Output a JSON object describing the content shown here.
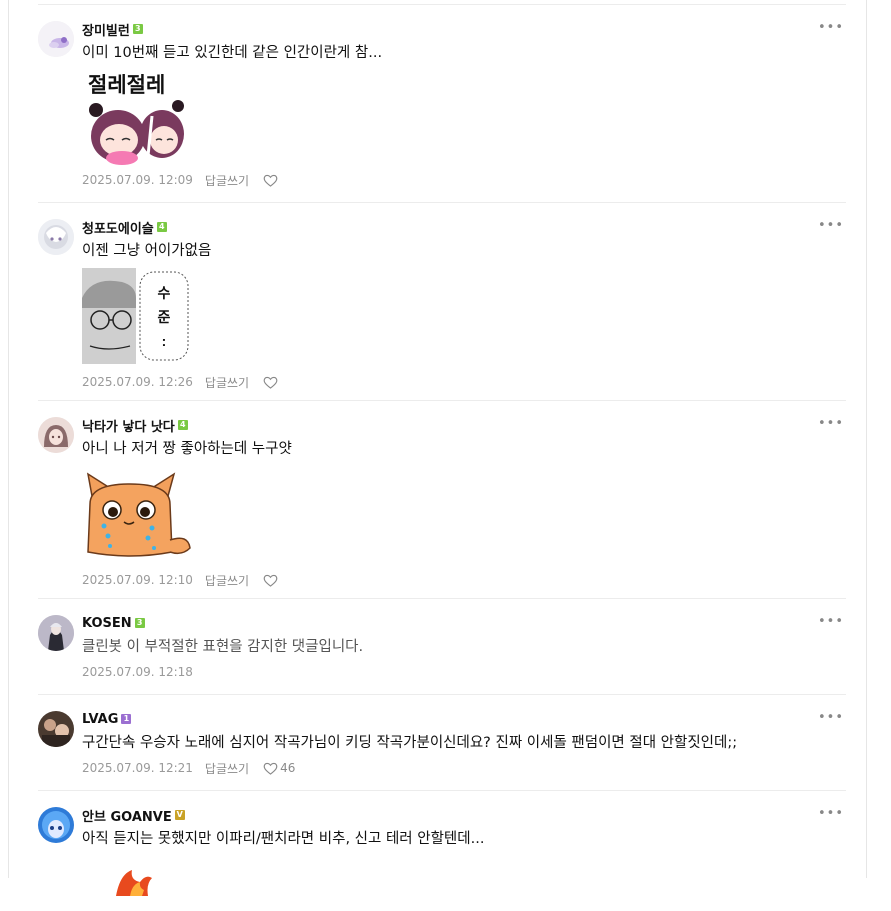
{
  "comments": [
    {
      "nick": "장미빌런",
      "level": "3",
      "level_color": "#7ac943",
      "text": "이미 10번째 듣고 있긴한데 같은 인간이란게 참...",
      "sticker_text": "절레절레",
      "date": "2025.07.09. 12:09",
      "reply": "답글쓰기",
      "likes": ""
    },
    {
      "nick": "청포도에이슬",
      "level": "4",
      "level_color": "#7ac943",
      "text": "이젠 그냥 어이가없음",
      "sticker_text": [
        "수",
        "준",
        ":"
      ],
      "date": "2025.07.09. 12:26",
      "reply": "답글쓰기",
      "likes": ""
    },
    {
      "nick": "낙타가 낳다 낫다",
      "level": "4",
      "level_color": "#7ac943",
      "text": "아니 나 저거 짱 좋아하는데 누구얏",
      "date": "2025.07.09. 12:10",
      "reply": "답글쓰기",
      "likes": ""
    },
    {
      "nick": "KOSEN",
      "level": "3",
      "level_color": "#7ac943",
      "text": "클린봇 이 부적절한 표현을 감지한 댓글입니다.",
      "date": "2025.07.09. 12:18"
    },
    {
      "nick": "LVAG",
      "level": "1",
      "level_color": "#9b6fd1",
      "text": "구간단속 우승자 노래에 심지어 작곡가님이 키딩 작곡가분이신데요? 진짜 이세돌 팬덤이면 절대 안할짓인데;;",
      "date": "2025.07.09. 12:21",
      "reply": "답글쓰기",
      "likes": "46"
    },
    {
      "nick": "안브 GOANVE",
      "level": "V",
      "level_color": "#c9a227",
      "text": "아직 듣지는 못했지만 이파리/팬치라면 비추, 신고 테러 안할텐데..."
    }
  ]
}
